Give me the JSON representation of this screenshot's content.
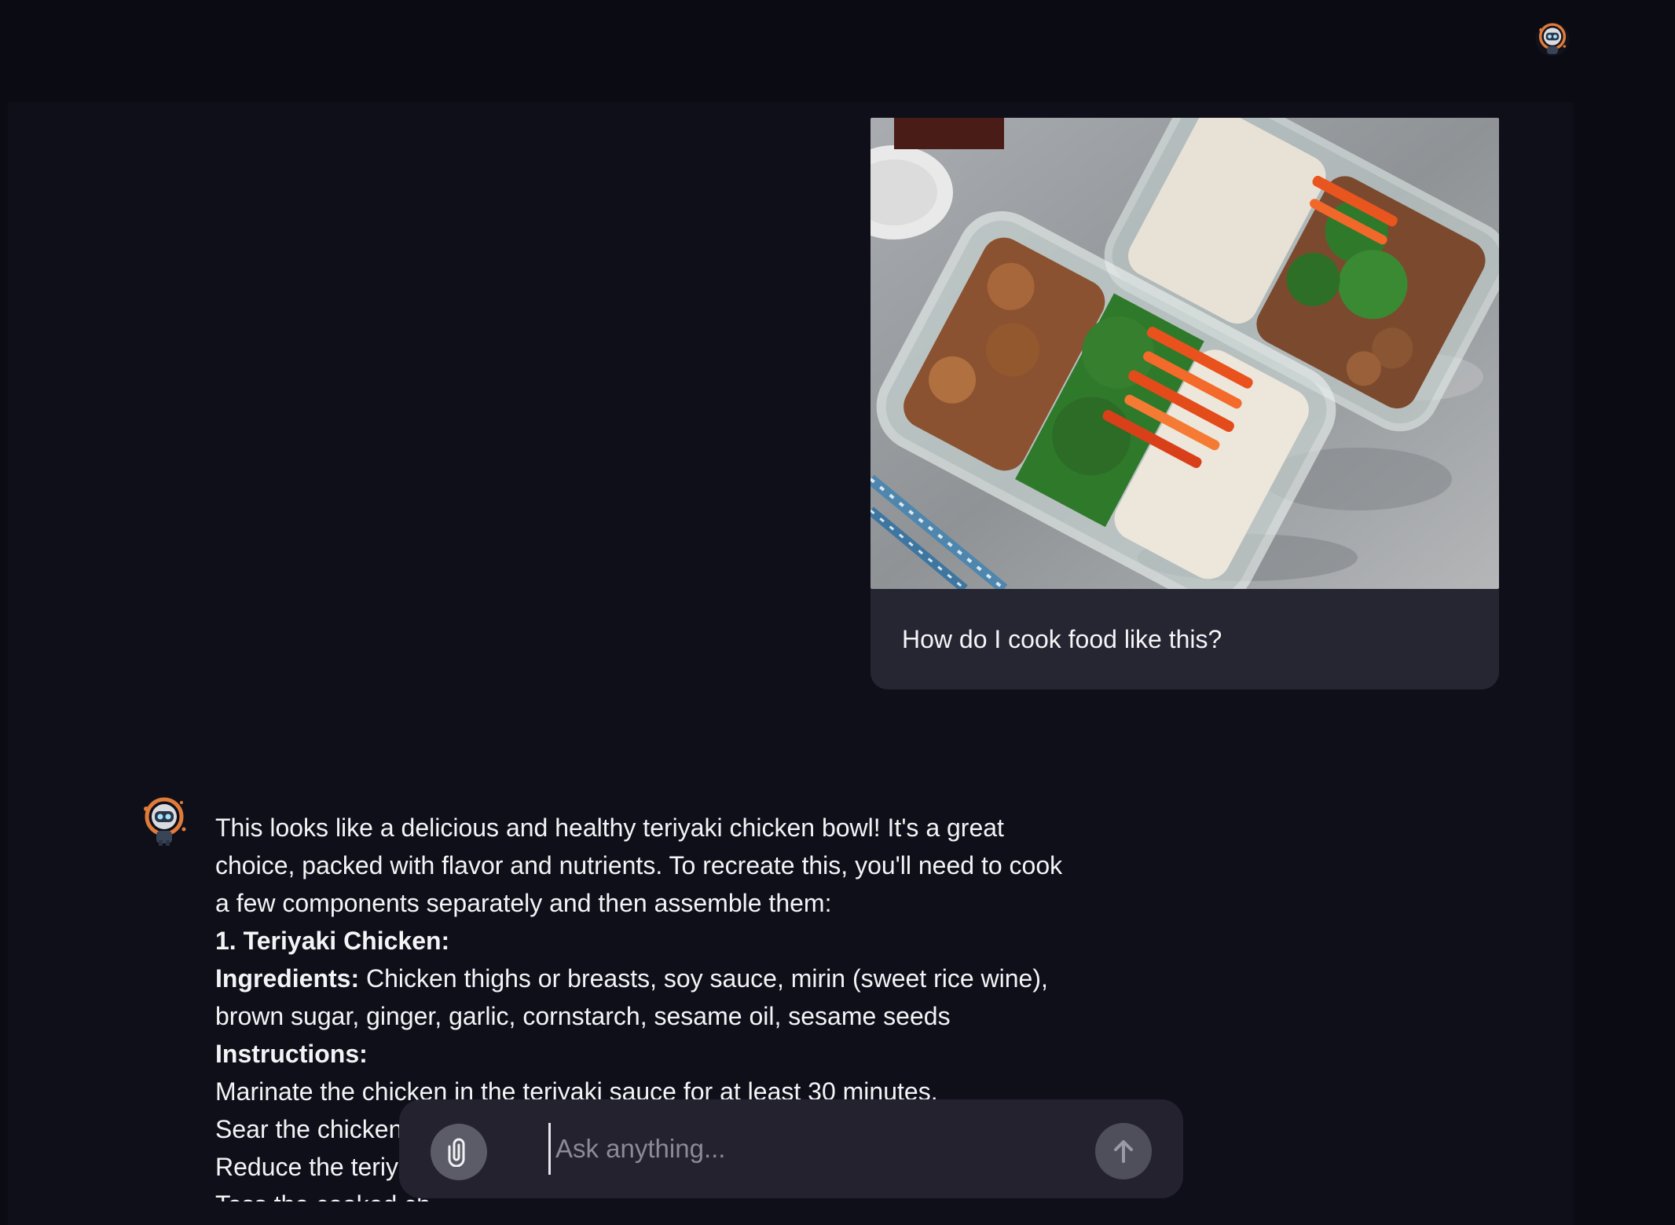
{
  "user_message": {
    "text": "How do I cook food like this?"
  },
  "assistant_message": {
    "intro": "This looks like a delicious and healthy teriyaki chicken bowl! It's a great choice, packed with flavor and nutrients. To recreate this, you'll need to cook a few components separately and then assemble them:",
    "section_title": "1. Teriyaki Chicken:",
    "ingredients_label": "Ingredients:",
    "ingredients_text": " Chicken thighs or breasts, soy sauce, mirin (sweet rice wine), brown sugar, ginger, garlic, cornstarch, sesame oil, sesame seeds",
    "instructions_label": "Instructions:",
    "steps": [
      "Marinate the chicken in the teriyaki sauce for at least 30 minutes.",
      "Sear the chicken",
      "Reduce the teriy",
      "Toss the cooked ch"
    ]
  },
  "composer": {
    "placeholder": "Ask anything..."
  },
  "icons": {
    "attach": "paperclip-icon",
    "send": "arrow-up-icon",
    "avatar": "robot-avatar-icon"
  },
  "colors": {
    "background": "#0b0b14",
    "panel": "#0f0f1a",
    "bubble": "#262532",
    "composer": "#23222e",
    "avatar_accent": "#e07b39"
  }
}
